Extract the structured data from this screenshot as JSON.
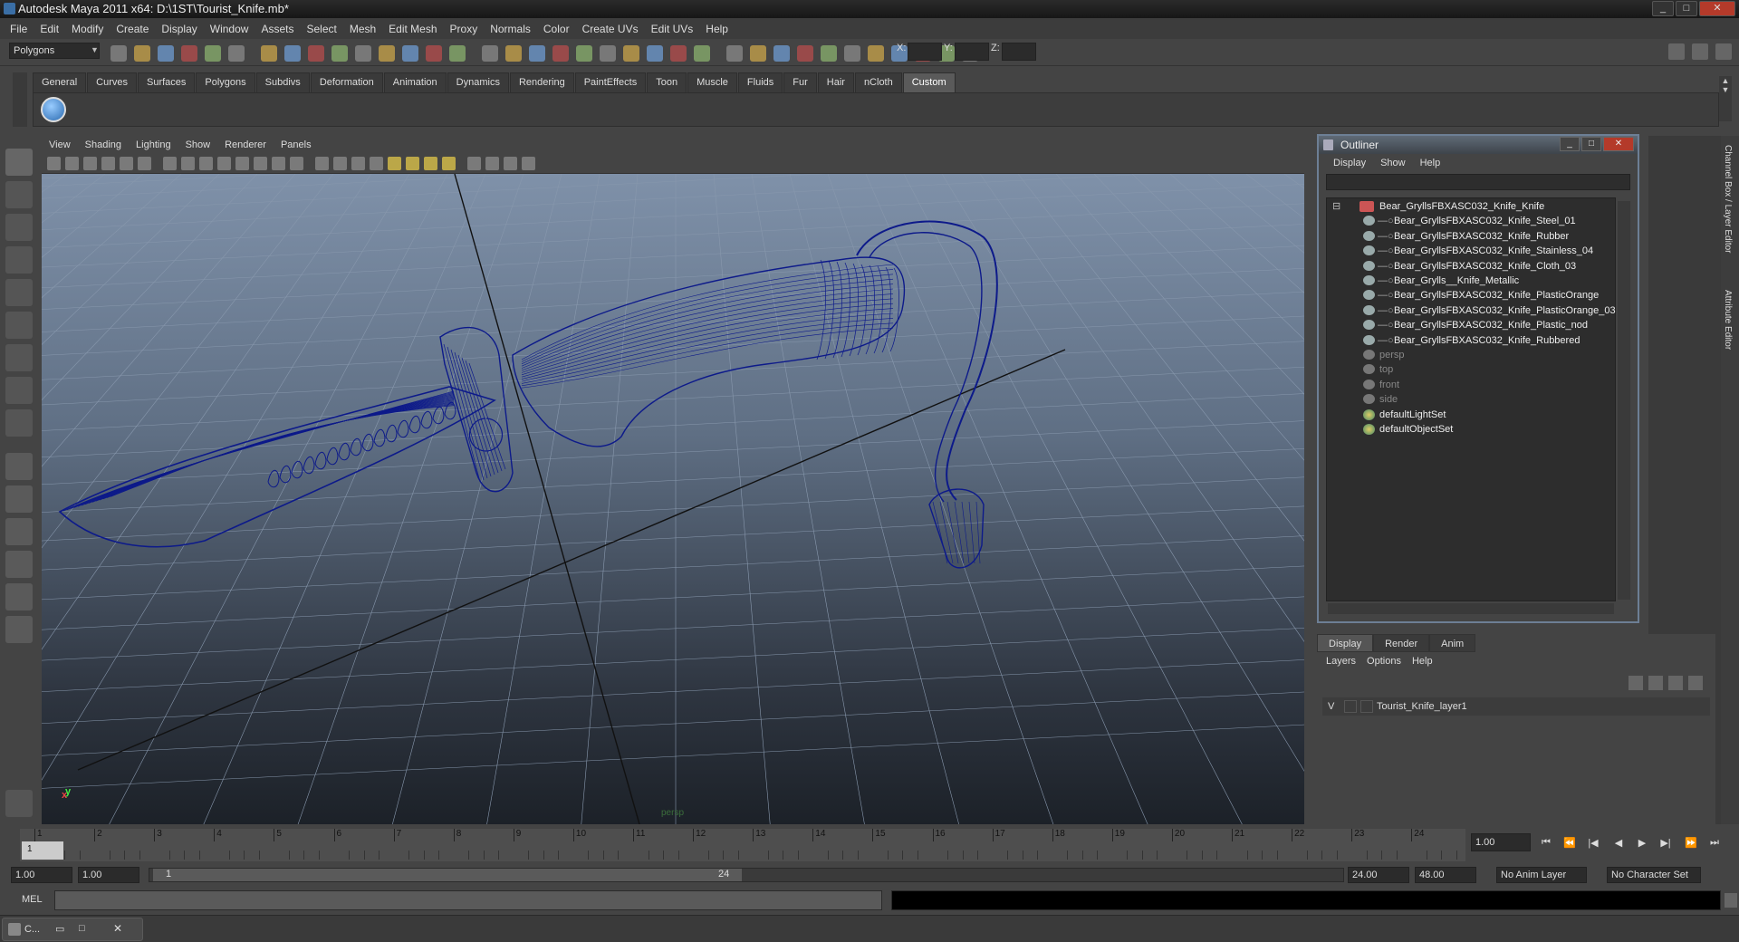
{
  "window": {
    "title": "Autodesk Maya 2011 x64: D:\\1ST\\Tourist_Knife.mb*",
    "minimize": "_",
    "maximize": "□",
    "close": "✕"
  },
  "menubar": [
    "File",
    "Edit",
    "Modify",
    "Create",
    "Display",
    "Window",
    "Assets",
    "Select",
    "Mesh",
    "Edit Mesh",
    "Proxy",
    "Normals",
    "Color",
    "Create UVs",
    "Edit UVs",
    "Help"
  ],
  "status": {
    "mode": "Polygons",
    "x_label": "X:",
    "y_label": "Y:",
    "z_label": "Z:"
  },
  "shelf_tabs": [
    "General",
    "Curves",
    "Surfaces",
    "Polygons",
    "Subdivs",
    "Deformation",
    "Animation",
    "Dynamics",
    "Rendering",
    "PaintEffects",
    "Toon",
    "Muscle",
    "Fluids",
    "Fur",
    "Hair",
    "nCloth",
    "Custom"
  ],
  "shelf_active": "Custom",
  "viewport": {
    "menu": [
      "View",
      "Shading",
      "Lighting",
      "Show",
      "Renderer",
      "Panels"
    ],
    "camera_label": "persp",
    "wire_color": "#0d1a8a"
  },
  "outliner": {
    "title": "Outliner",
    "menu": [
      "Display",
      "Show",
      "Help"
    ],
    "root": "Bear_GryllsFBXASC032_Knife_Knife",
    "children": [
      "Bear_GryllsFBXASC032_Knife_Steel_01",
      "Bear_GryllsFBXASC032_Knife_Rubber",
      "Bear_GryllsFBXASC032_Knife_Stainless_04",
      "Bear_GryllsFBXASC032_Knife_Cloth_03",
      "Bear_Grylls__Knife_Metallic",
      "Bear_GryllsFBXASC032_Knife_PlasticOrange",
      "Bear_GryllsFBXASC032_Knife_PlasticOrange_03",
      "Bear_GryllsFBXASC032_Knife_Plastic_nod",
      "Bear_GryllsFBXASC032_Knife_Rubbered"
    ],
    "cameras": [
      "persp",
      "top",
      "front",
      "side"
    ],
    "sets": [
      "defaultLightSet",
      "defaultObjectSet"
    ]
  },
  "side_tabs": [
    "Channel Box / Layer Editor",
    "Attribute Editor"
  ],
  "layers": {
    "tabs": [
      "Display",
      "Render",
      "Anim"
    ],
    "active_tab": "Display",
    "menu": [
      "Layers",
      "Options",
      "Help"
    ],
    "row": {
      "visible": "V",
      "name": "Tourist_Knife_layer1"
    }
  },
  "timeline": {
    "ticks": [
      "1",
      "2",
      "3",
      "4",
      "5",
      "6",
      "7",
      "8",
      "9",
      "10",
      "11",
      "12",
      "13",
      "14",
      "15",
      "16",
      "17",
      "18",
      "19",
      "20",
      "21",
      "22",
      "23",
      "24"
    ],
    "current": "1",
    "current_frame_field": "1.00"
  },
  "range": {
    "start": "1.00",
    "start2": "1.00",
    "slider_start": "1",
    "slider_end": "24",
    "end": "24.00",
    "end2": "48.00",
    "anim_layer": "No Anim Layer",
    "char_set": "No Character Set"
  },
  "cmd": {
    "label": "MEL"
  },
  "taskbar": {
    "item": "C..."
  }
}
